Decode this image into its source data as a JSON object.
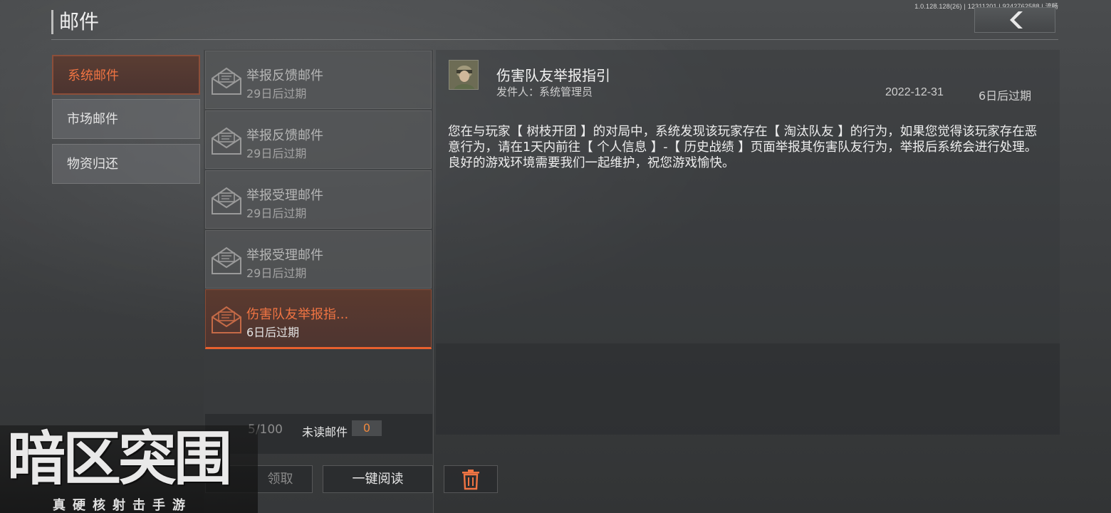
{
  "version": "1.0.128.128(26) | 12311201 | 9242762588 | 流畅",
  "header": {
    "title": "邮件",
    "back_icon": "chevron-left-icon"
  },
  "categories": [
    {
      "label": "系统邮件",
      "active": true
    },
    {
      "label": "市场邮件",
      "active": false
    },
    {
      "label": "物资归还",
      "active": false
    }
  ],
  "mails": [
    {
      "title": "举报反馈邮件",
      "expiry": "29日后过期",
      "icon": "envelope-open-icon"
    },
    {
      "title": "举报反馈邮件",
      "expiry": "29日后过期",
      "icon": "envelope-open-icon"
    },
    {
      "title": "举报受理邮件",
      "expiry": "29日后过期",
      "icon": "envelope-open-icon"
    },
    {
      "title": "举报受理邮件",
      "expiry": "29日后过期",
      "icon": "envelope-open-icon"
    },
    {
      "title": "伤害队友举报指...",
      "expiry": "6日后过期",
      "icon": "envelope-open-icon",
      "active": true
    }
  ],
  "footer": {
    "count": "5/100",
    "unread_label": "未读邮件",
    "unread_count": "0",
    "claim_label": "领取",
    "read_all_label": "一键阅读",
    "delete_icon": "trash-icon"
  },
  "detail": {
    "title": "伤害队友举报指引",
    "sender": "发件人：系统管理员",
    "date": "2022-12-31",
    "expiry": "6日后过期",
    "body": "您在与玩家【 树枝开团 】的对局中，系统发现该玩家存在【 淘汰队友 】的行为，如果您觉得该玩家存在恶意行为，请在1天内前往【 个人信息 】-【 历史战绩 】页面举报其伤害队友行为，举报后系统会进行处理。良好的游戏环境需要我们一起维护，祝您游戏愉快。"
  },
  "logo": {
    "title": "暗区突围",
    "subtitle": "真硬核射击手游"
  },
  "colors": {
    "accent": "#f07443",
    "accent_border": "#e8602e"
  }
}
